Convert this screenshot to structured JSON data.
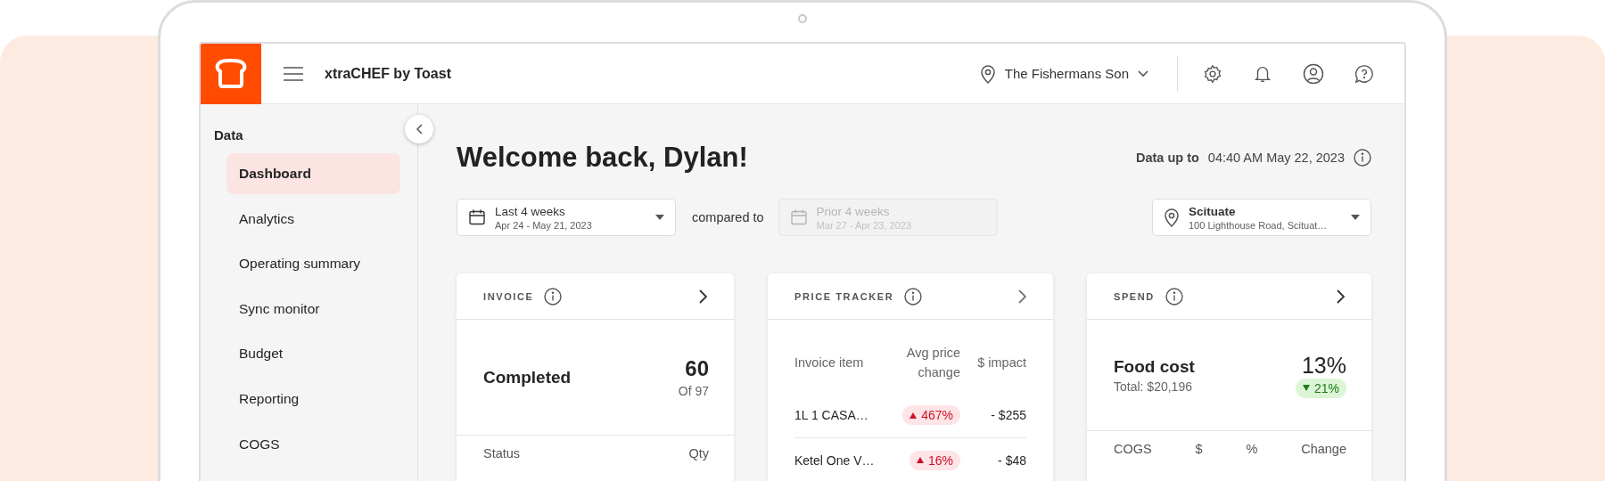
{
  "app": {
    "title": "xtraCHEF by Toast",
    "location": "The Fishermans Son"
  },
  "sidebar": {
    "section": "Data",
    "items": [
      {
        "label": "Dashboard",
        "selected": true
      },
      {
        "label": "Analytics",
        "selected": false
      },
      {
        "label": "Operating summary",
        "selected": false
      },
      {
        "label": "Sync monitor",
        "selected": false
      },
      {
        "label": "Budget",
        "selected": false
      },
      {
        "label": "Reporting",
        "selected": false
      },
      {
        "label": "COGS",
        "selected": false
      }
    ]
  },
  "header": {
    "greeting": "Welcome back, Dylan!",
    "data_up_to_label": "Data up to",
    "data_up_to_value": "04:40 AM May 22, 2023"
  },
  "filters": {
    "period": {
      "label": "Last 4 weeks",
      "range": "Apr 24 - May 21, 2023"
    },
    "compared_to": "compared to",
    "prior": {
      "label": "Prior 4 weeks",
      "range": "Mar 27 - Apr 23, 2023",
      "disabled": true
    },
    "location": {
      "name": "Scituate",
      "address": "100 Lighthouse Road, Scituat…"
    }
  },
  "cards": [
    {
      "kind": "invoice",
      "title": "INVOICE",
      "status": "Completed",
      "count": "60",
      "total": "Of 97",
      "columns": [
        "Status",
        "Qty"
      ]
    },
    {
      "kind": "price",
      "title": "PRICE TRACKER",
      "columns": [
        "Invoice item",
        "Avg price change",
        "$ impact"
      ],
      "rows": [
        {
          "item": "1L 1 CASA…",
          "change": "467%",
          "increase": true,
          "impact": "- $255"
        },
        {
          "item": "Ketel One V…",
          "change": "16%",
          "increase": true,
          "impact": "- $48"
        }
      ]
    },
    {
      "kind": "spend",
      "title": "SPEND",
      "metric": "Food cost",
      "total": "Total: $20,196",
      "percent": "13%",
      "change": "21%",
      "increase": false,
      "columns": [
        "COGS",
        "$",
        "%",
        "Change"
      ]
    }
  ]
}
